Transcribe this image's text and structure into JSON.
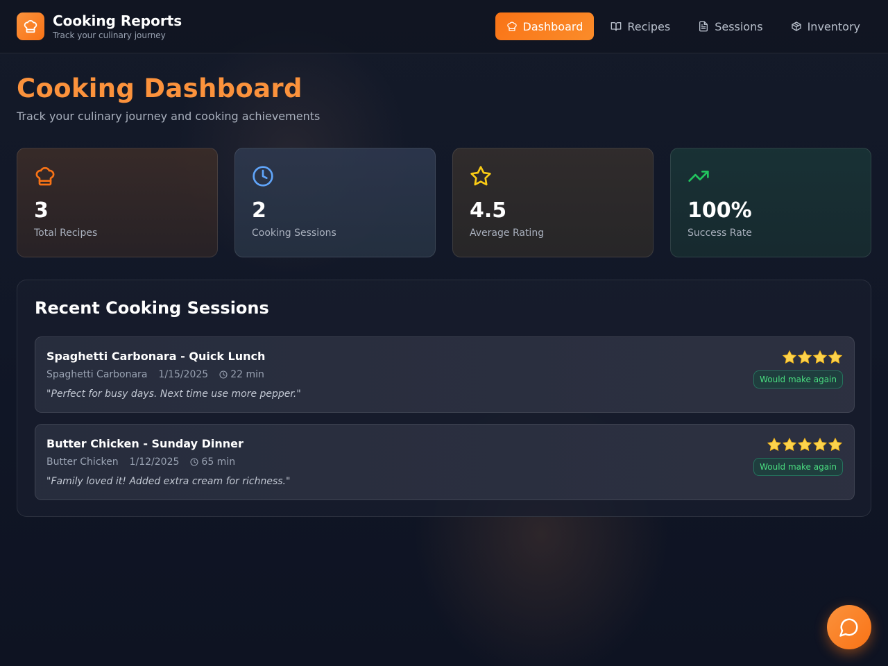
{
  "app": {
    "title": "Cooking Reports",
    "subtitle": "Track your culinary journey",
    "logo_icon": "chef-hat-icon",
    "accent": "#f97316"
  },
  "nav": {
    "items": [
      {
        "label": "Dashboard",
        "icon": "chef-hat-icon",
        "active": true
      },
      {
        "label": "Recipes",
        "icon": "book-open-icon",
        "active": false
      },
      {
        "label": "Sessions",
        "icon": "file-text-icon",
        "active": false
      },
      {
        "label": "Inventory",
        "icon": "package-icon",
        "active": false
      }
    ]
  },
  "page": {
    "title": "Cooking Dashboard",
    "subtitle": "Track your culinary journey and cooking achievements"
  },
  "stats": [
    {
      "value": "3",
      "label": "Total Recipes",
      "icon": "chef-hat-icon",
      "color": "#f97316"
    },
    {
      "value": "2",
      "label": "Cooking Sessions",
      "icon": "clock-icon",
      "color": "#60a5fa"
    },
    {
      "value": "4.5",
      "label": "Average Rating",
      "icon": "star-icon",
      "color": "#facc15"
    },
    {
      "value": "100%",
      "label": "Success Rate",
      "icon": "trending-up-icon",
      "color": "#22c55e"
    }
  ],
  "recent": {
    "title": "Recent Cooking Sessions",
    "sessions": [
      {
        "title": "Spaghetti Carbonara - Quick Lunch",
        "recipe": "Spaghetti Carbonara",
        "date": "1/15/2025",
        "duration": "22 min",
        "note": "\"Perfect for busy days. Next time use more pepper.\"",
        "rating": 4,
        "badge": "Would make again"
      },
      {
        "title": "Butter Chicken - Sunday Dinner",
        "recipe": "Butter Chicken",
        "date": "1/12/2025",
        "duration": "65 min",
        "note": "\"Family loved it! Added extra cream for richness.\"",
        "rating": 5,
        "badge": "Would make again"
      }
    ]
  },
  "chat": {
    "icon": "message-circle-icon"
  }
}
